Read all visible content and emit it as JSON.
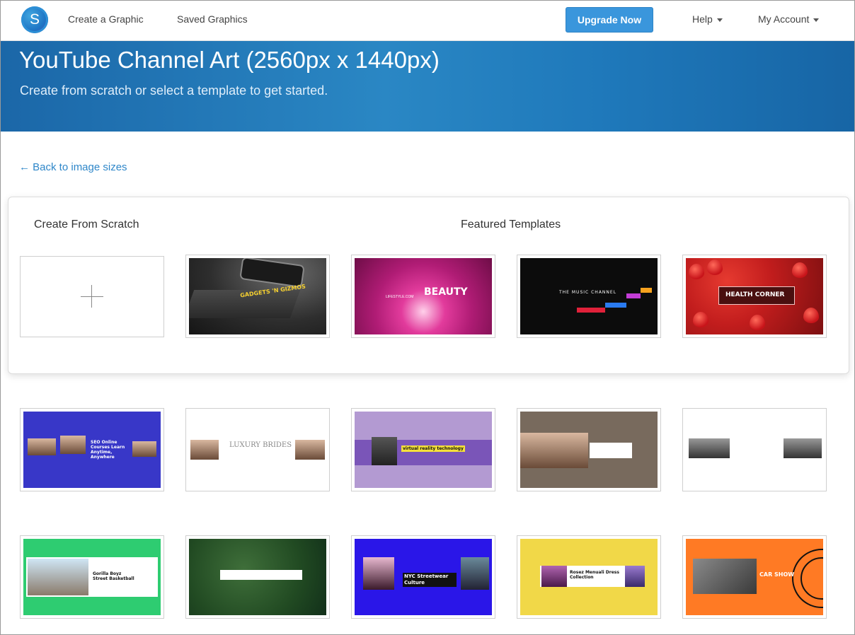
{
  "nav": {
    "logo_letter": "S",
    "create_label": "Create a Graphic",
    "saved_label": "Saved Graphics",
    "upgrade_label": "Upgrade Now",
    "help_label": "Help",
    "account_label": "My Account"
  },
  "hero": {
    "title": "YouTube Channel Art (2560px x 1440px)",
    "subtitle": "Create from scratch or select a template to get started."
  },
  "back_link": "← Back to image sizes",
  "sections": {
    "scratch_heading": "Create From Scratch",
    "featured_heading": "Featured Templates"
  },
  "templates": {
    "gadgets": "GADGETS 'N GIZMOS",
    "beauty": "BEAUTY",
    "beauty_site": "LIFESTYLE.COM",
    "music": "THE MUSIC CHANNEL",
    "health": "HEALTH CORNER",
    "seo": "SEO Online Courses Learn Anytime, Anywhere",
    "brides": "LUXURY BRIDES",
    "vr": "virtual reality technology",
    "gorilla": "Gorilla Boyz Street Basketball",
    "nyc": "NYC Streetwear Culture",
    "dress": "Rosez Menuali Dress Collection",
    "car": "CAR SHOW"
  },
  "colors": {
    "accent": "#3a96dc",
    "hero_start": "#1b67a8",
    "link": "#2f87c9"
  }
}
